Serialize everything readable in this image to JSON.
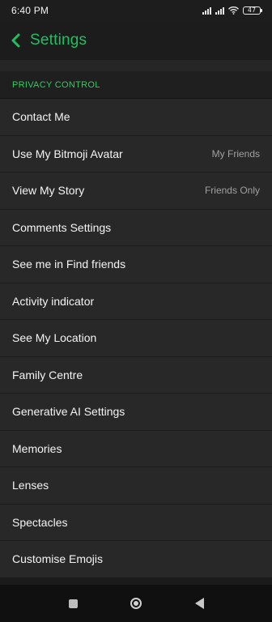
{
  "status_bar": {
    "time": "6:40 PM",
    "battery": "47",
    "icons": [
      "signal-icon",
      "signal-icon",
      "wifi-icon",
      "battery-icon"
    ]
  },
  "header": {
    "title": "Settings",
    "back_icon": "chevron-left-icon",
    "accent_color": "#1fc05f"
  },
  "section": {
    "title": "PRIVACY CONTROL"
  },
  "items": [
    {
      "label": "Contact Me",
      "value": ""
    },
    {
      "label": "Use My Bitmoji Avatar",
      "value": "My Friends"
    },
    {
      "label": "View My Story",
      "value": "Friends Only"
    },
    {
      "label": "Comments Settings",
      "value": ""
    },
    {
      "label": "See me in Find friends",
      "value": ""
    },
    {
      "label": "Activity indicator",
      "value": ""
    },
    {
      "label": "See My Location",
      "value": ""
    },
    {
      "label": "Family Centre",
      "value": ""
    },
    {
      "label": "Generative AI Settings",
      "value": ""
    },
    {
      "label": "Memories",
      "value": ""
    },
    {
      "label": "Lenses",
      "value": ""
    },
    {
      "label": "Spectacles",
      "value": ""
    },
    {
      "label": "Customise Emojis",
      "value": ""
    }
  ],
  "nav_bar": {
    "icons": [
      "recents-square-icon",
      "home-circle-icon",
      "back-triangle-icon"
    ]
  }
}
